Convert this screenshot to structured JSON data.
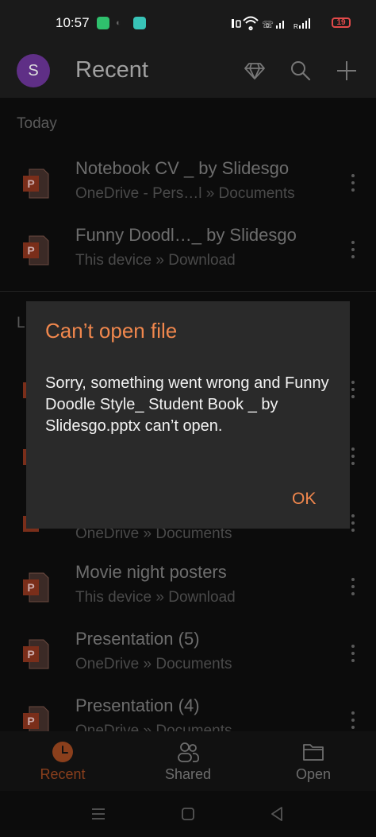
{
  "status_bar": {
    "time": "10:57",
    "battery": "19"
  },
  "app_bar": {
    "avatar_letter": "S",
    "title": "Recent"
  },
  "sections": {
    "today": "Today",
    "earlier_partial": "L"
  },
  "files": [
    {
      "name": "Notebook CV _ by Slidesgo",
      "location": "OneDrive - Pers…l » Documents"
    },
    {
      "name": "Funny Doodl…_ by Slidesgo",
      "location": "This device » Download"
    },
    {
      "name": "",
      "location": "OneDrive » Documents"
    },
    {
      "name": "Movie night posters",
      "location": "This device » Download"
    },
    {
      "name": "Presentation (5)",
      "location": "OneDrive » Documents"
    },
    {
      "name": "Presentation (4)",
      "location": "OneDrive » Documents"
    }
  ],
  "dialog": {
    "title": "Can’t open file",
    "message": "Sorry, something went wrong and Funny Doodle Style_ Student Book _ by Slidesgo.pptx can’t open.",
    "ok_label": "OK"
  },
  "bottom_nav": {
    "recent": "Recent",
    "shared": "Shared",
    "open": "Open"
  },
  "colors": {
    "accent": "#f0874d",
    "powerpoint": "#c43e1c",
    "avatar": "#5f2f86"
  }
}
